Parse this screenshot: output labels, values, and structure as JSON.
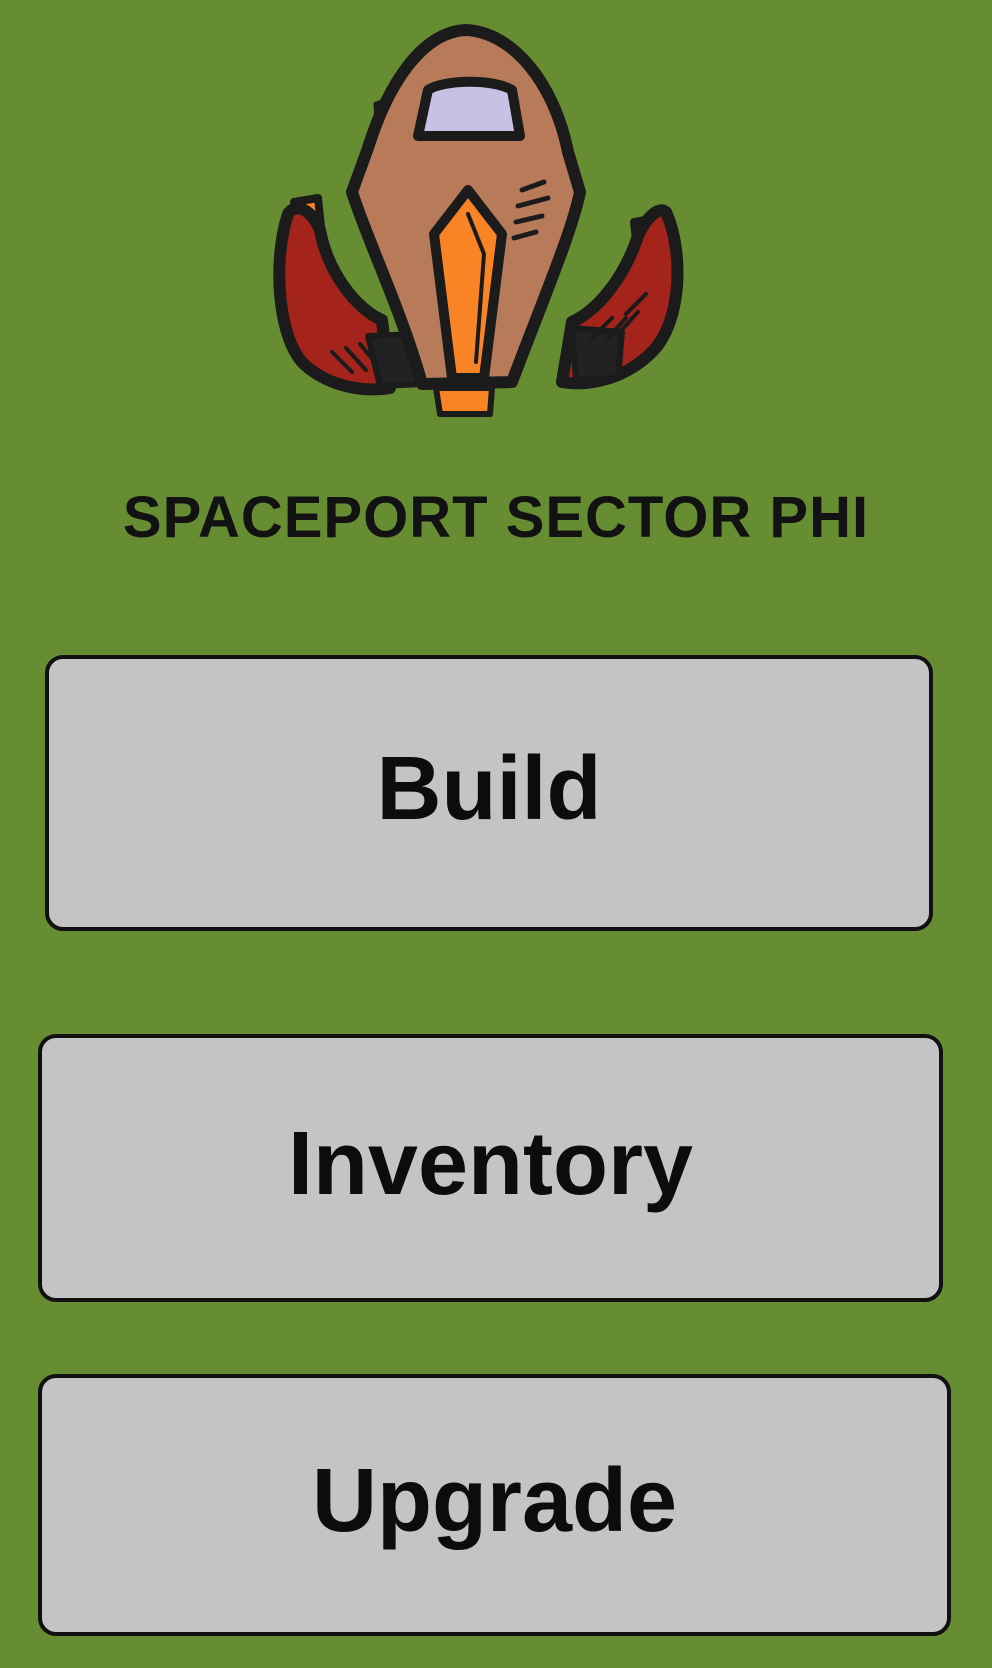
{
  "title": "SPACEPORT SECTOR PHI",
  "logo": {
    "icon": "spaceship-icon",
    "colors": {
      "hull": "#b87b5a",
      "cockpit": "#c9c0e6",
      "flame": "#f88426",
      "wing": "#a4231b",
      "outline": "#1b1b1b"
    }
  },
  "menu": {
    "build_label": "Build",
    "inventory_label": "Inventory",
    "upgrade_label": "Upgrade"
  },
  "colors": {
    "background": "#678d33",
    "button": "#c4c4c4",
    "button_border": "#111111",
    "text": "#0c0c0c"
  }
}
